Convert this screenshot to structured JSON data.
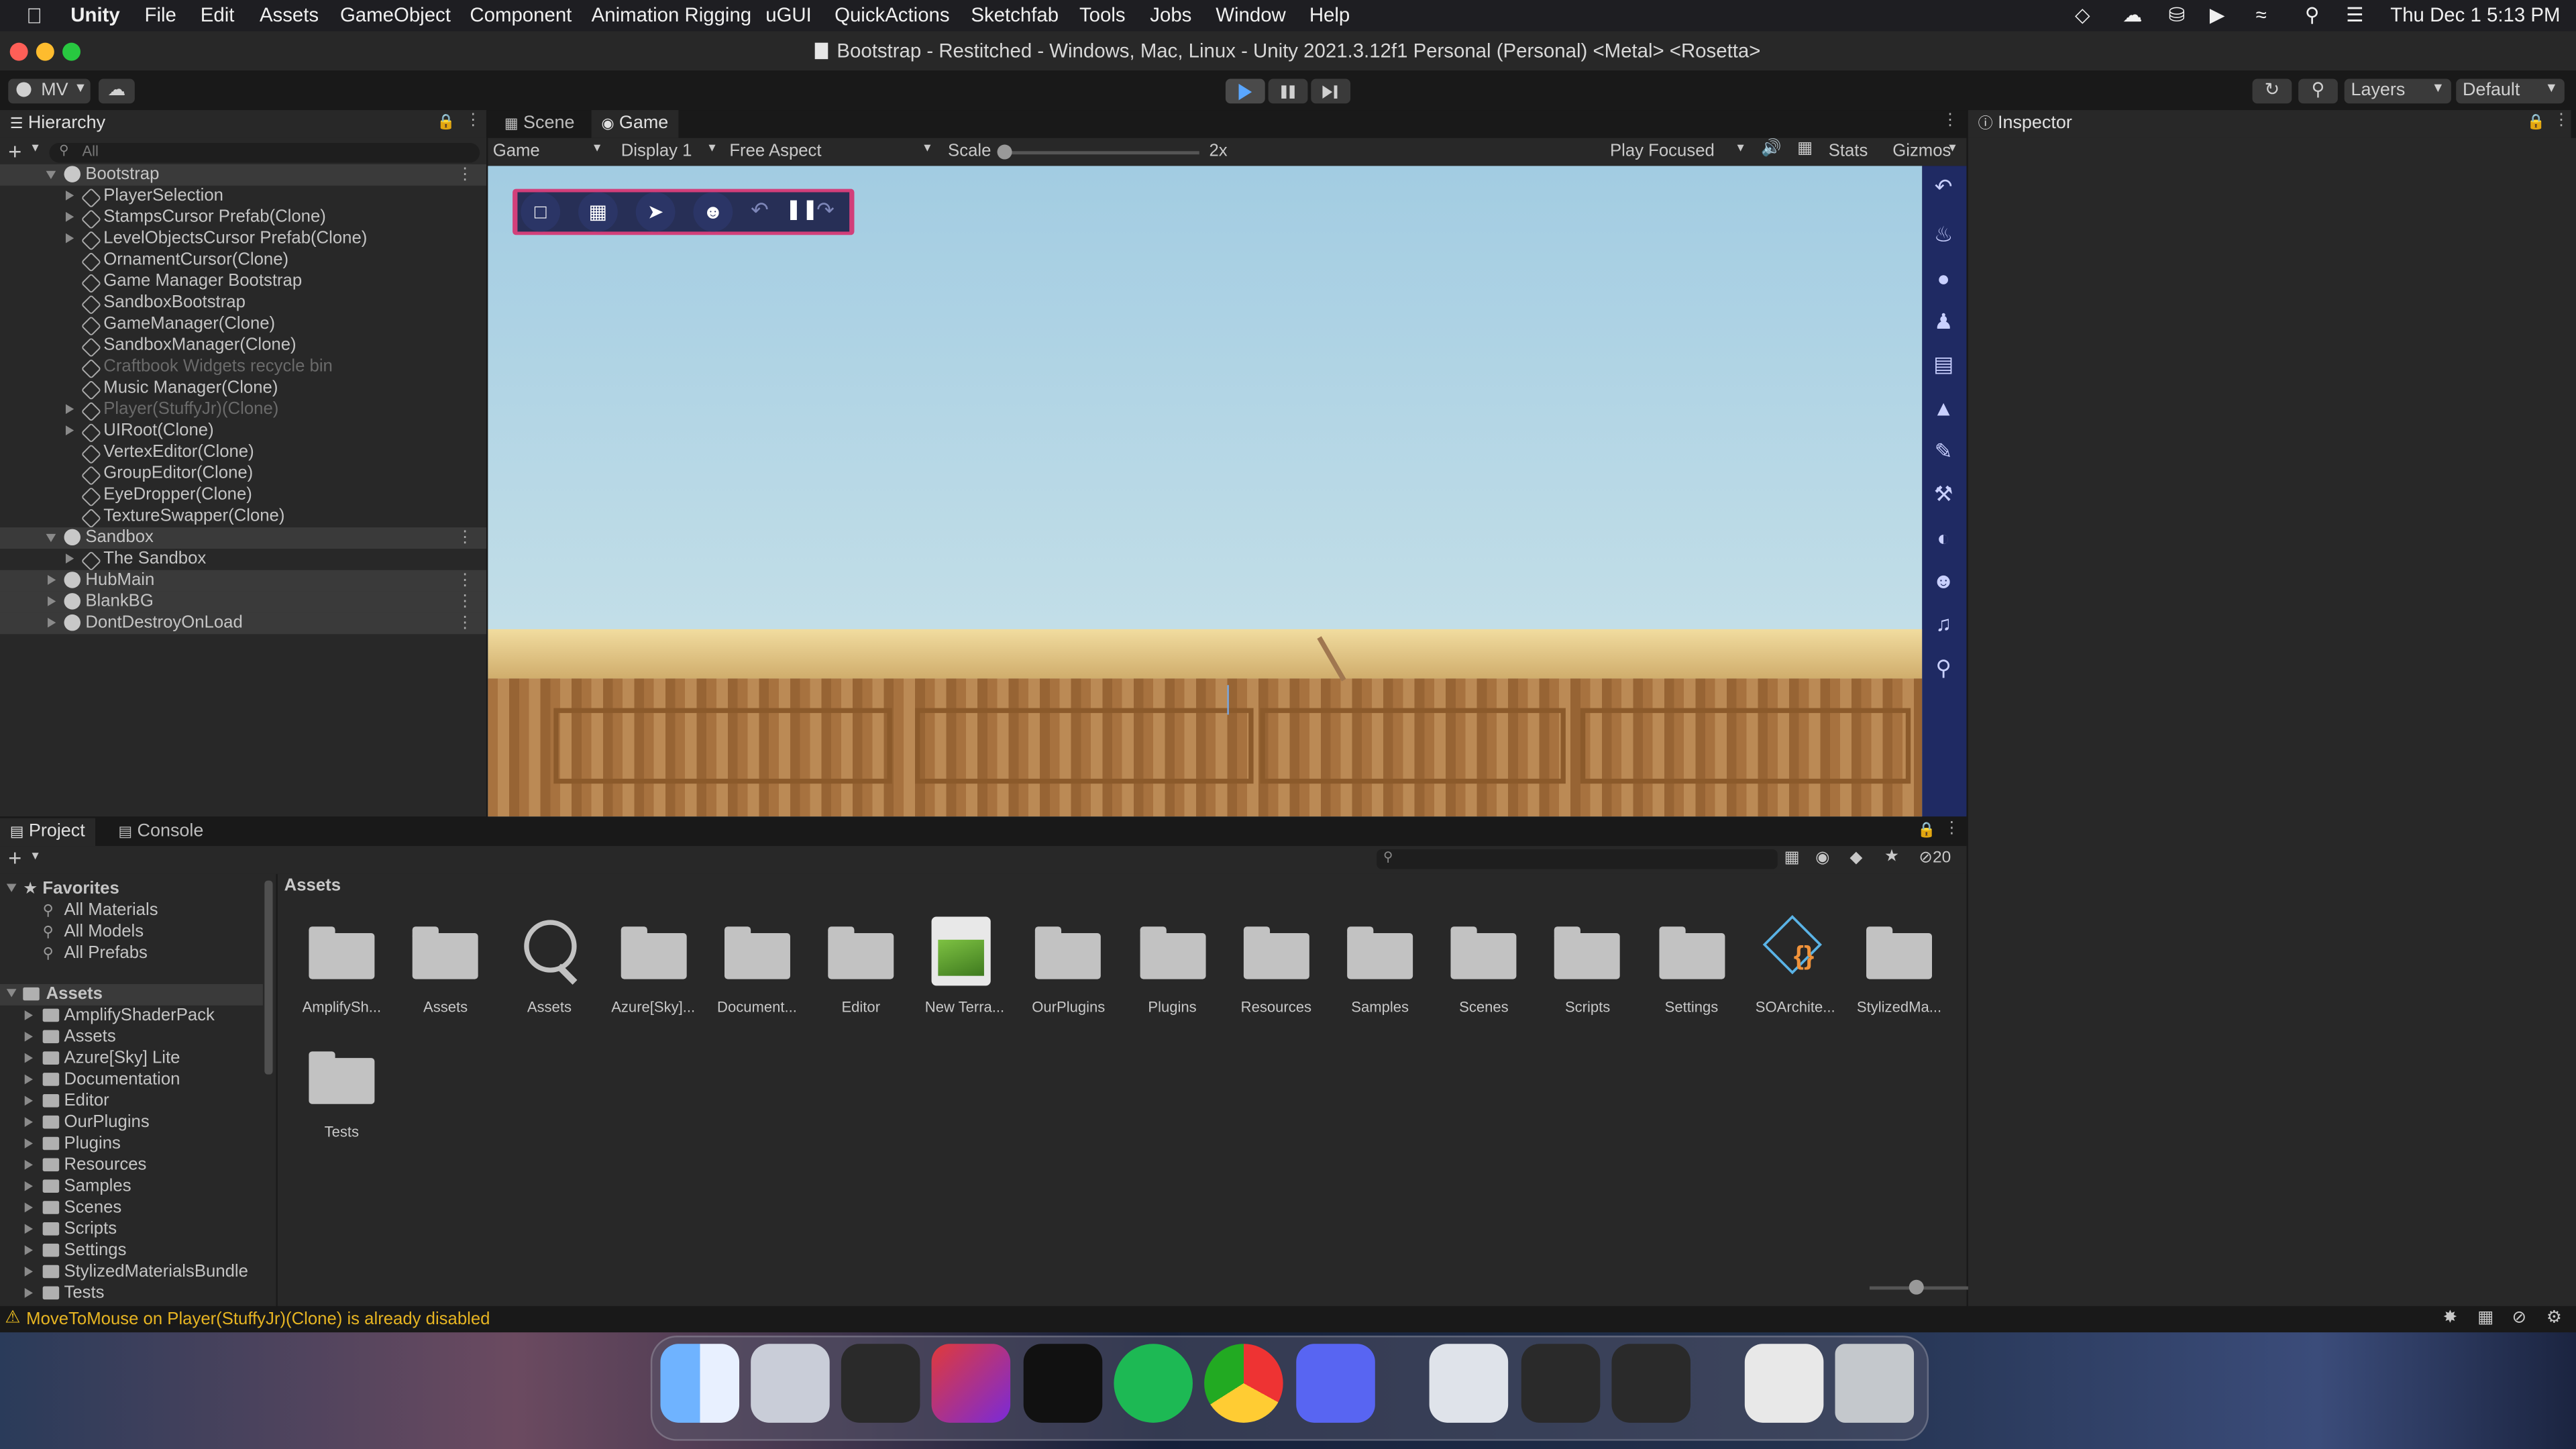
{
  "menubar": {
    "app": "Unity",
    "items": [
      "File",
      "Edit",
      "Assets",
      "GameObject",
      "Component",
      "Animation Rigging",
      "uGUI",
      "QuickActions",
      "Sketchfab",
      "Tools",
      "Jobs",
      "Window",
      "Help"
    ],
    "clock": "Thu Dec 1  5:13 PM"
  },
  "window": {
    "title": "Bootstrap - Restitched - Windows, Mac, Linux - Unity 2021.3.12f1 Personal (Personal) <Metal> <Rosetta>"
  },
  "toolbar": {
    "account": "MV",
    "layers": "Layers",
    "layout": "Default"
  },
  "hierarchy": {
    "tab": "Hierarchy",
    "search_placeholder": "All",
    "rows": [
      {
        "label": "Bootstrap",
        "type": "scene",
        "expanded": true
      },
      {
        "label": "PlayerSelection",
        "type": "child",
        "arrow": true
      },
      {
        "label": "StampsCursor Prefab(Clone)",
        "type": "child",
        "arrow": true
      },
      {
        "label": "LevelObjectsCursor Prefab(Clone)",
        "type": "child",
        "arrow": true
      },
      {
        "label": "OrnamentCursor(Clone)",
        "type": "child"
      },
      {
        "label": "Game Manager Bootstrap",
        "type": "child"
      },
      {
        "label": "SandboxBootstrap",
        "type": "child"
      },
      {
        "label": "GameManager(Clone)",
        "type": "child"
      },
      {
        "label": "SandboxManager(Clone)",
        "type": "child"
      },
      {
        "label": "Craftbook Widgets recycle bin",
        "type": "child",
        "disabled": true
      },
      {
        "label": "Music Manager(Clone)",
        "type": "child"
      },
      {
        "label": "Player(StuffyJr)(Clone)",
        "type": "child",
        "arrow": true,
        "disabled": true
      },
      {
        "label": "UIRoot(Clone)",
        "type": "child",
        "arrow": true
      },
      {
        "label": "VertexEditor(Clone)",
        "type": "child"
      },
      {
        "label": "GroupEditor(Clone)",
        "type": "child"
      },
      {
        "label": "EyeDropper(Clone)",
        "type": "child"
      },
      {
        "label": "TextureSwapper(Clone)",
        "type": "child"
      },
      {
        "label": "Sandbox",
        "type": "scene",
        "expanded": true
      },
      {
        "label": "The Sandbox",
        "type": "child",
        "arrow": true
      },
      {
        "label": "HubMain",
        "type": "scene"
      },
      {
        "label": "BlankBG",
        "type": "scene"
      },
      {
        "label": "DontDestroyOnLoad",
        "type": "scene"
      }
    ]
  },
  "game_view": {
    "tabs": [
      "Scene",
      "Game"
    ],
    "mode": "Game",
    "display": "Display 1",
    "aspect": "Free Aspect",
    "scale_label": "Scale",
    "scale_value": "2x",
    "play_mode": "Play Focused",
    "stats": "Stats",
    "gizmos": "Gizmos"
  },
  "inspector": {
    "tab": "Inspector"
  },
  "project": {
    "tabs": [
      "Project",
      "Console"
    ],
    "hidden_count": "20",
    "breadcrumb": "Assets",
    "favorites_label": "Favorites",
    "favorites": [
      "All Materials",
      "All Models",
      "All Prefabs"
    ],
    "assets_label": "Assets",
    "tree": [
      "AmplifyShaderPack",
      "Assets",
      "Azure[Sky] Lite",
      "Documentation",
      "Editor",
      "OurPlugins",
      "Plugins",
      "Resources",
      "Samples",
      "Scenes",
      "Scripts",
      "Settings",
      "StylizedMaterialsBundle",
      "Tests"
    ],
    "grid": [
      {
        "label": "AmplifySh...",
        "kind": "folder"
      },
      {
        "label": "Assets",
        "kind": "folder"
      },
      {
        "label": "Assets",
        "kind": "search"
      },
      {
        "label": "Azure[Sky]...",
        "kind": "folder"
      },
      {
        "label": "Document...",
        "kind": "folder"
      },
      {
        "label": "Editor",
        "kind": "folder"
      },
      {
        "label": "New Terra...",
        "kind": "terrain"
      },
      {
        "label": "OurPlugins",
        "kind": "folder"
      },
      {
        "label": "Plugins",
        "kind": "folder"
      },
      {
        "label": "Resources",
        "kind": "folder"
      },
      {
        "label": "Samples",
        "kind": "folder"
      },
      {
        "label": "Scenes",
        "kind": "folder"
      },
      {
        "label": "Scripts",
        "kind": "folder"
      },
      {
        "label": "Settings",
        "kind": "folder"
      },
      {
        "label": "SOArchite...",
        "kind": "so"
      },
      {
        "label": "StylizedMa...",
        "kind": "folder"
      },
      {
        "label": "Tests",
        "kind": "folder"
      }
    ]
  },
  "status": {
    "warning": "MoveToMouse on Player(StuffyJr)(Clone) is already disabled"
  },
  "dock": [
    "Finder",
    "Launchpad",
    "Unity Hub",
    "Rider",
    "Terminal",
    "Spotify",
    "Chrome",
    "Discord",
    "Preview",
    "Unity",
    "Unity",
    "Image",
    "Trash"
  ]
}
